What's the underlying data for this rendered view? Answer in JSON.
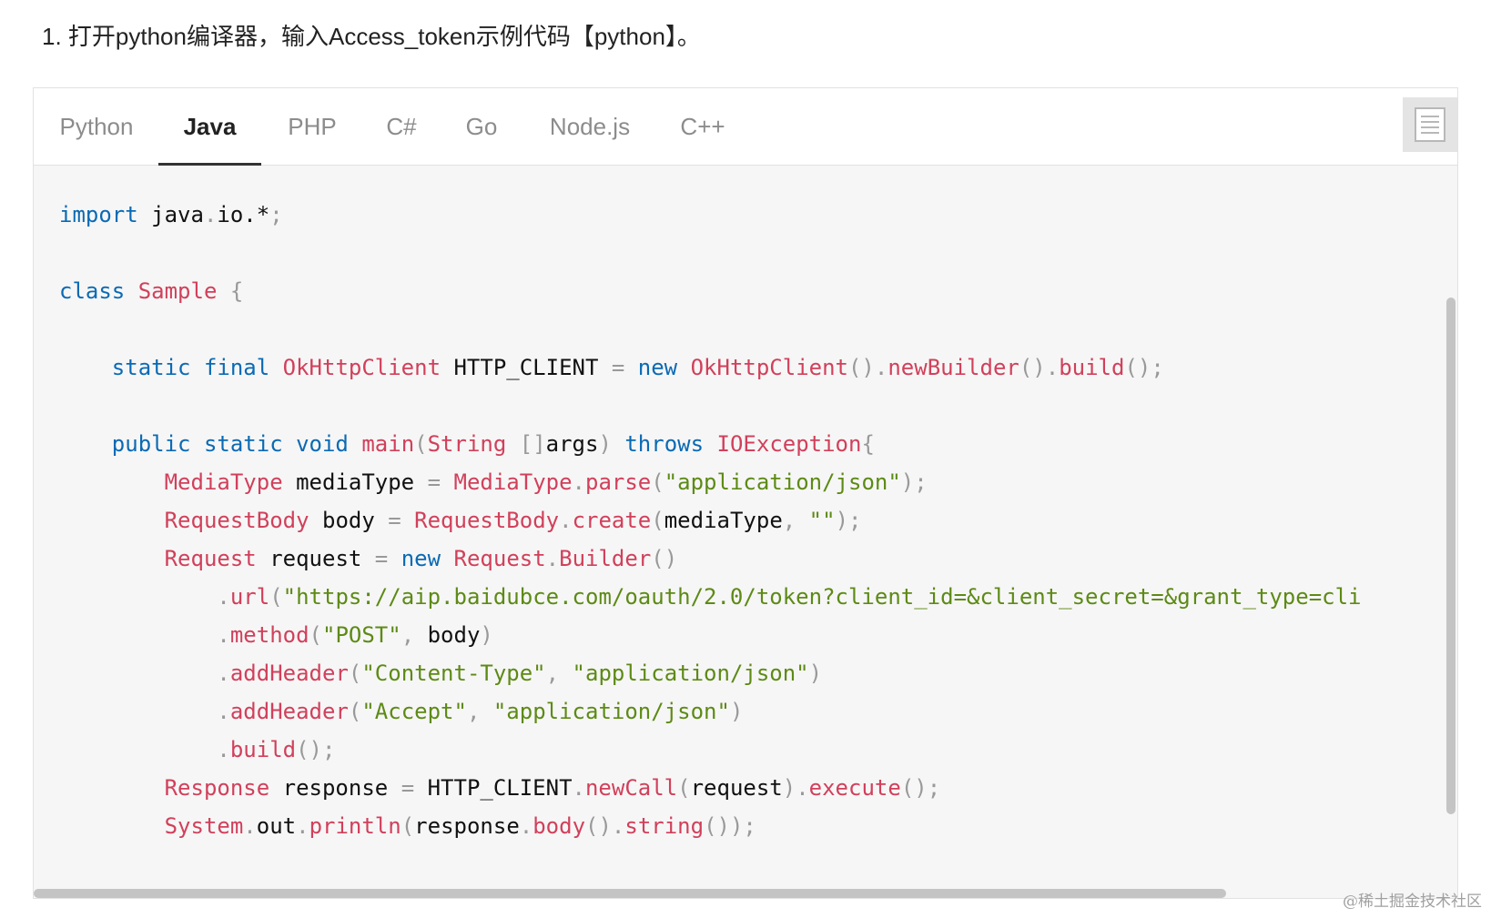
{
  "instruction": "1. 打开python编译器，输入Access_token示例代码【python】。",
  "tabs": [
    {
      "label": "Python",
      "active": false
    },
    {
      "label": "Java",
      "active": true
    },
    {
      "label": "PHP",
      "active": false
    },
    {
      "label": "C#",
      "active": false
    },
    {
      "label": "Go",
      "active": false
    },
    {
      "label": "Node.js",
      "active": false
    },
    {
      "label": "C++",
      "active": false
    }
  ],
  "copy_icon": "copy-document-icon",
  "colors": {
    "keyword": "#0a6ab4",
    "type": "#d1405b",
    "string": "#5d8a15",
    "punct": "#999999",
    "identifier": "#111111"
  },
  "code": {
    "language": "Java",
    "lines": [
      [
        [
          "kw",
          "import"
        ],
        [
          "id",
          " java"
        ],
        [
          "pu",
          "."
        ],
        [
          "id",
          "io.*"
        ],
        [
          "pu",
          ";"
        ]
      ],
      [],
      [
        [
          "kw",
          "class"
        ],
        [
          "id",
          " "
        ],
        [
          "ty",
          "Sample"
        ],
        [
          "id",
          " "
        ],
        [
          "pu",
          "{"
        ]
      ],
      [],
      [
        [
          "id",
          "    "
        ],
        [
          "kw",
          "static final"
        ],
        [
          "id",
          " "
        ],
        [
          "ty",
          "OkHttpClient"
        ],
        [
          "id",
          " HTTP_CLIENT "
        ],
        [
          "pu",
          "="
        ],
        [
          "id",
          " "
        ],
        [
          "kw",
          "new"
        ],
        [
          "id",
          " "
        ],
        [
          "ty",
          "OkHttpClient"
        ],
        [
          "pu",
          "()."
        ],
        [
          "ty",
          "newBuilder"
        ],
        [
          "pu",
          "()."
        ],
        [
          "ty",
          "build"
        ],
        [
          "pu",
          "();"
        ]
      ],
      [],
      [
        [
          "id",
          "    "
        ],
        [
          "kw",
          "public static void"
        ],
        [
          "id",
          " "
        ],
        [
          "ty",
          "main"
        ],
        [
          "pu",
          "("
        ],
        [
          "ty",
          "String"
        ],
        [
          "id",
          " "
        ],
        [
          "pu",
          "[]"
        ],
        [
          "id",
          "args"
        ],
        [
          "pu",
          ")"
        ],
        [
          "id",
          " "
        ],
        [
          "kw",
          "throws"
        ],
        [
          "id",
          " "
        ],
        [
          "ty",
          "IOException"
        ],
        [
          "pu",
          "{"
        ]
      ],
      [
        [
          "id",
          "        "
        ],
        [
          "ty",
          "MediaType"
        ],
        [
          "id",
          " mediaType "
        ],
        [
          "pu",
          "="
        ],
        [
          "id",
          " "
        ],
        [
          "ty",
          "MediaType"
        ],
        [
          "pu",
          "."
        ],
        [
          "ty",
          "parse"
        ],
        [
          "pu",
          "("
        ],
        [
          "str",
          "\"application/json\""
        ],
        [
          "pu",
          ");"
        ]
      ],
      [
        [
          "id",
          "        "
        ],
        [
          "ty",
          "RequestBody"
        ],
        [
          "id",
          " body "
        ],
        [
          "pu",
          "="
        ],
        [
          "id",
          " "
        ],
        [
          "ty",
          "RequestBody"
        ],
        [
          "pu",
          "."
        ],
        [
          "ty",
          "create"
        ],
        [
          "pu",
          "("
        ],
        [
          "id",
          "mediaType"
        ],
        [
          "pu",
          ","
        ],
        [
          "id",
          " "
        ],
        [
          "str",
          "\"\""
        ],
        [
          "pu",
          ");"
        ]
      ],
      [
        [
          "id",
          "        "
        ],
        [
          "ty",
          "Request"
        ],
        [
          "id",
          " request "
        ],
        [
          "pu",
          "="
        ],
        [
          "id",
          " "
        ],
        [
          "kw",
          "new"
        ],
        [
          "id",
          " "
        ],
        [
          "ty",
          "Request"
        ],
        [
          "pu",
          "."
        ],
        [
          "ty",
          "Builder"
        ],
        [
          "pu",
          "()"
        ]
      ],
      [
        [
          "id",
          "            "
        ],
        [
          "pu",
          "."
        ],
        [
          "ty",
          "url"
        ],
        [
          "pu",
          "("
        ],
        [
          "str",
          "\"https://aip.baidubce.com/oauth/2.0/token?client_id=&client_secret=&grant_type=cli"
        ]
      ],
      [
        [
          "id",
          "            "
        ],
        [
          "pu",
          "."
        ],
        [
          "ty",
          "method"
        ],
        [
          "pu",
          "("
        ],
        [
          "str",
          "\"POST\""
        ],
        [
          "pu",
          ","
        ],
        [
          "id",
          " body"
        ],
        [
          "pu",
          ")"
        ]
      ],
      [
        [
          "id",
          "            "
        ],
        [
          "pu",
          "."
        ],
        [
          "ty",
          "addHeader"
        ],
        [
          "pu",
          "("
        ],
        [
          "str",
          "\"Content-Type\""
        ],
        [
          "pu",
          ","
        ],
        [
          "id",
          " "
        ],
        [
          "str",
          "\"application/json\""
        ],
        [
          "pu",
          ")"
        ]
      ],
      [
        [
          "id",
          "            "
        ],
        [
          "pu",
          "."
        ],
        [
          "ty",
          "addHeader"
        ],
        [
          "pu",
          "("
        ],
        [
          "str",
          "\"Accept\""
        ],
        [
          "pu",
          ","
        ],
        [
          "id",
          " "
        ],
        [
          "str",
          "\"application/json\""
        ],
        [
          "pu",
          ")"
        ]
      ],
      [
        [
          "id",
          "            "
        ],
        [
          "pu",
          "."
        ],
        [
          "ty",
          "build"
        ],
        [
          "pu",
          "();"
        ]
      ],
      [
        [
          "id",
          "        "
        ],
        [
          "ty",
          "Response"
        ],
        [
          "id",
          " response "
        ],
        [
          "pu",
          "="
        ],
        [
          "id",
          " HTTP_CLIENT"
        ],
        [
          "pu",
          "."
        ],
        [
          "ty",
          "newCall"
        ],
        [
          "pu",
          "("
        ],
        [
          "id",
          "request"
        ],
        [
          "pu",
          ")."
        ],
        [
          "ty",
          "execute"
        ],
        [
          "pu",
          "();"
        ]
      ],
      [
        [
          "id",
          "        "
        ],
        [
          "ty",
          "System"
        ],
        [
          "pu",
          "."
        ],
        [
          "id",
          "out"
        ],
        [
          "pu",
          "."
        ],
        [
          "ty",
          "println"
        ],
        [
          "pu",
          "("
        ],
        [
          "id",
          "response"
        ],
        [
          "pu",
          "."
        ],
        [
          "ty",
          "body"
        ],
        [
          "pu",
          "()."
        ],
        [
          "ty",
          "string"
        ],
        [
          "pu",
          "());"
        ]
      ]
    ]
  },
  "watermark": "@稀土掘金技术社区"
}
